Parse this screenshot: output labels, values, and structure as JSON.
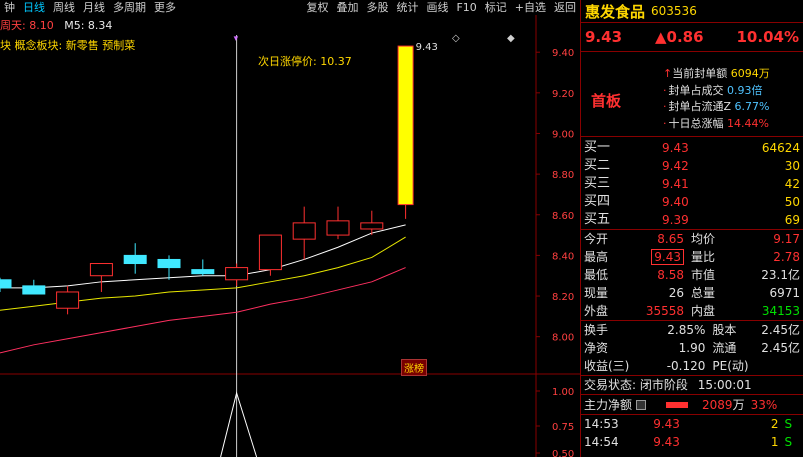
{
  "toolbar": {
    "left_items": [
      "钟",
      "日线",
      "周线",
      "月线",
      "多周期",
      "更多"
    ],
    "right_items": [
      "复权",
      "叠加",
      "多股",
      "统计",
      "画线",
      "F10",
      "标记",
      "+自选",
      "返回"
    ]
  },
  "chart_header": {
    "ma_a": "周天: 8.10",
    "ma_b": "M5: 8.34",
    "concept": "块  概念板块:  新零售 预制菜"
  },
  "annotations": {
    "next_day_limit": "次日涨停价: 10.37",
    "high_label": "9.43",
    "limit_tag": "涨榜"
  },
  "chart_data": {
    "type": "candlestick",
    "y_ticks": [
      "9.40",
      "9.20",
      "9.00",
      "8.80",
      "8.60",
      "8.40",
      "8.20",
      "8.00"
    ],
    "ylim": [
      7.9,
      9.46
    ],
    "sub_y_ticks": [
      "1.00",
      "0.75",
      "0.50"
    ],
    "candles": [
      {
        "o": 8.24,
        "h": 8.29,
        "l": 8.22,
        "c": 8.28,
        "up": false
      },
      {
        "o": 8.25,
        "h": 8.28,
        "l": 8.22,
        "c": 8.21,
        "up": false
      },
      {
        "o": 8.22,
        "h": 8.25,
        "l": 8.11,
        "c": 8.14,
        "up": true
      },
      {
        "o": 8.3,
        "h": 8.33,
        "l": 8.22,
        "c": 8.36,
        "up": true
      },
      {
        "o": 8.4,
        "h": 8.46,
        "l": 8.31,
        "c": 8.36,
        "up": false
      },
      {
        "o": 8.38,
        "h": 8.4,
        "l": 8.28,
        "c": 8.34,
        "up": false
      },
      {
        "o": 8.33,
        "h": 8.38,
        "l": 8.3,
        "c": 8.31,
        "up": false
      },
      {
        "o": 8.34,
        "h": 8.36,
        "l": 8.25,
        "c": 8.28,
        "up": true
      },
      {
        "o": 8.33,
        "h": 8.5,
        "l": 8.3,
        "c": 8.5,
        "up": true
      },
      {
        "o": 8.48,
        "h": 8.64,
        "l": 8.38,
        "c": 8.56,
        "up": true
      },
      {
        "o": 8.5,
        "h": 8.64,
        "l": 8.48,
        "c": 8.57,
        "up": true
      },
      {
        "o": 8.53,
        "h": 8.62,
        "l": 8.5,
        "c": 8.56,
        "up": true
      },
      {
        "o": 8.65,
        "h": 9.43,
        "l": 8.58,
        "c": 9.43,
        "up": true
      }
    ],
    "ma_white": [
      8.24,
      8.24,
      8.25,
      8.27,
      8.28,
      8.29,
      8.3,
      8.3,
      8.33,
      8.38,
      8.44,
      8.51,
      8.55
    ],
    "ma_yellow": [
      8.13,
      8.15,
      8.17,
      8.19,
      8.2,
      8.22,
      8.23,
      8.24,
      8.27,
      8.3,
      8.34,
      8.39,
      8.49
    ],
    "ma_red": [
      7.92,
      7.96,
      7.99,
      8.02,
      8.05,
      8.08,
      8.1,
      8.12,
      8.16,
      8.19,
      8.23,
      8.27,
      8.34
    ],
    "colors": {
      "up": "#ff3030",
      "down": "#40e8ff",
      "limit_fill": "#ffff00",
      "ma_white": "#ffffff",
      "ma_yellow": "#e8e800",
      "ma_red": "#ff3060"
    }
  },
  "panel": {
    "name": "惠发食品",
    "code": "603536",
    "price": "9.43",
    "change": "▲0.86",
    "change_pct": "10.04%",
    "seal_badge": "首板",
    "seal": [
      {
        "label": "当前封单额",
        "value": "6094万"
      },
      {
        "label": "封单占成交",
        "value": "0.93倍"
      },
      {
        "label": "封单占流通Z",
        "value": "6.77%"
      },
      {
        "label": "十日总涨幅",
        "value": "14.44%"
      }
    ],
    "bids": [
      {
        "label": "买一",
        "price": "9.43",
        "vol": "64624"
      },
      {
        "label": "买二",
        "price": "9.42",
        "vol": "30"
      },
      {
        "label": "买三",
        "price": "9.41",
        "vol": "42"
      },
      {
        "label": "买四",
        "price": "9.40",
        "vol": "50"
      },
      {
        "label": "买五",
        "price": "9.39",
        "vol": "69"
      }
    ],
    "stats": [
      {
        "k": "今开",
        "v": "8.65",
        "k2": "均价",
        "v2": "9.17"
      },
      {
        "k": "最高",
        "v": "9.43",
        "k2": "量比",
        "v2": "2.78"
      },
      {
        "k": "最低",
        "v": "8.58",
        "k2": "市值",
        "v2": "23.1亿"
      },
      {
        "k": "现量",
        "v": "26",
        "k2": "总量",
        "v2": "6971"
      },
      {
        "k": "外盘",
        "v": "35558",
        "k2": "内盘",
        "v2": "34153"
      }
    ],
    "stats2": [
      {
        "k": "换手",
        "v": "2.85%",
        "k2": "股本",
        "v2": "2.45亿"
      },
      {
        "k": "净资",
        "v": "1.90",
        "k2": "流通",
        "v2": "2.45亿"
      },
      {
        "k": "收益(三)",
        "v": "-0.120",
        "k2": "PE(动)",
        "v2": ""
      }
    ],
    "trade_state_label": "交易状态:",
    "trade_state": "闭市阶段",
    "trade_time": "15:00:01",
    "mainflow_label": "主力净额",
    "mainflow_amt": "2089",
    "mainflow_unit": "万",
    "mainflow_pct": "33%",
    "ticks": [
      {
        "t": "14:53",
        "p": "9.43",
        "n": "2",
        "s": "S"
      },
      {
        "t": "14:54",
        "p": "9.43",
        "n": "1",
        "s": "S"
      }
    ]
  }
}
